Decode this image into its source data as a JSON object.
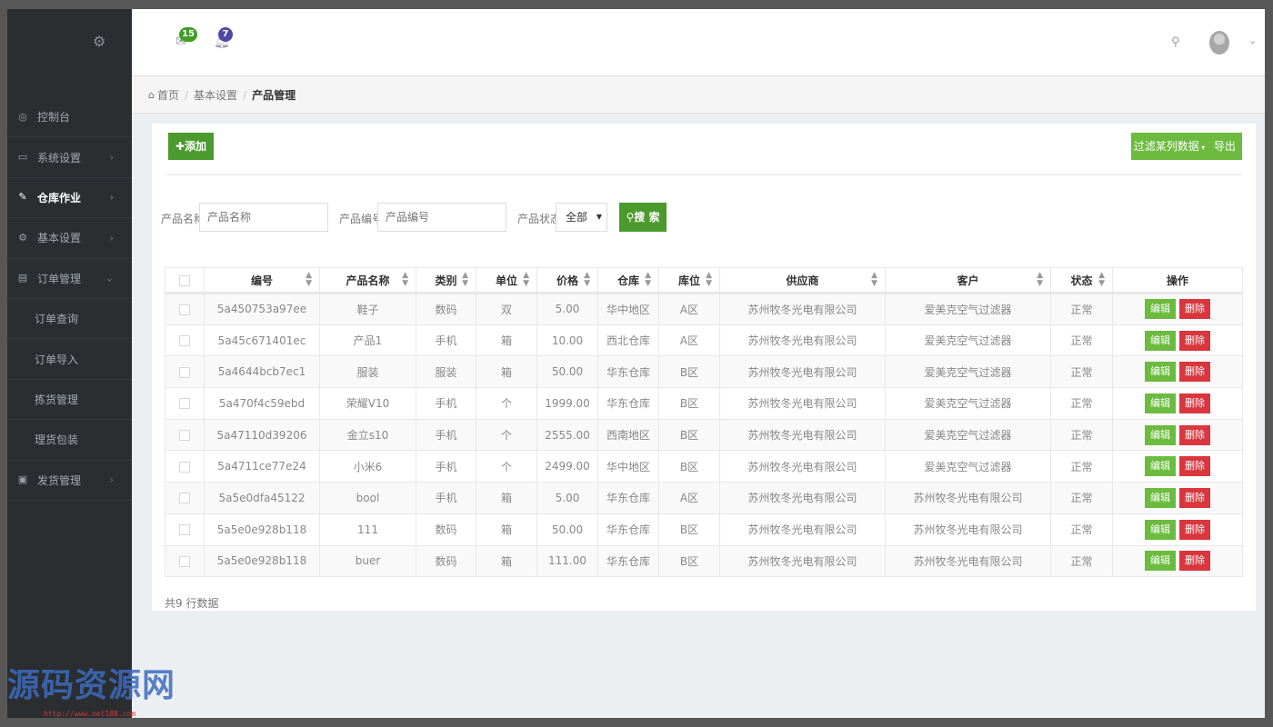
{
  "header": {
    "mail_badge": "15",
    "bell_badge": "7"
  },
  "sidebar": {
    "items": [
      {
        "label": "控制台",
        "icon": "dashboard-icon"
      },
      {
        "label": "系统设置",
        "icon": "monitor-icon"
      },
      {
        "label": "仓库作业",
        "icon": "edit-icon",
        "active": true
      },
      {
        "label": "基本设置",
        "icon": "gear-icon"
      },
      {
        "label": "订单管理",
        "icon": "file-icon",
        "expanded": true
      },
      {
        "label": "订单查询"
      },
      {
        "label": "订单导入"
      },
      {
        "label": "拣货管理"
      },
      {
        "label": "理货包装"
      },
      {
        "label": "发货管理",
        "icon": "truck-icon"
      }
    ]
  },
  "breadcrumb": {
    "home": "首页",
    "level1": "基本设置",
    "current": "产品管理"
  },
  "toolbar": {
    "add_label": "添加",
    "filter_label": "过滤某列数据",
    "export_label": "导出"
  },
  "search": {
    "name_label": "产品名称",
    "name_placeholder": "产品名称",
    "code_label": "产品编号",
    "code_placeholder": "产品编号",
    "status_label": "产品状态",
    "status_value": "全部",
    "search_label": "搜 索"
  },
  "table": {
    "columns": [
      "编号",
      "产品名称",
      "类别",
      "单位",
      "价格",
      "仓库",
      "库位",
      "供应商",
      "客户",
      "状态",
      "操作"
    ],
    "edit_label": "编辑",
    "delete_label": "删除",
    "rows": [
      [
        "5a450753a97ee",
        "鞋子",
        "数码",
        "双",
        "5.00",
        "华中地区",
        "A区",
        "苏州牧冬光电有限公司",
        "爱美克空气过滤器",
        "正常"
      ],
      [
        "5a45c671401ec",
        "产品1",
        "手机",
        "箱",
        "10.00",
        "西北仓库",
        "A区",
        "苏州牧冬光电有限公司",
        "爱美克空气过滤器",
        "正常"
      ],
      [
        "5a4644bcb7ec1",
        "服装",
        "服装",
        "箱",
        "50.00",
        "华东仓库",
        "B区",
        "苏州牧冬光电有限公司",
        "爱美克空气过滤器",
        "正常"
      ],
      [
        "5a470f4c59ebd",
        "荣耀V10",
        "手机",
        "个",
        "1999.00",
        "华东仓库",
        "B区",
        "苏州牧冬光电有限公司",
        "爱美克空气过滤器",
        "正常"
      ],
      [
        "5a47110d39206",
        "金立s10",
        "手机",
        "个",
        "2555.00",
        "西南地区",
        "B区",
        "苏州牧冬光电有限公司",
        "爱美克空气过滤器",
        "正常"
      ],
      [
        "5a4711ce77e24",
        "小米6",
        "手机",
        "个",
        "2499.00",
        "华中地区",
        "B区",
        "苏州牧冬光电有限公司",
        "爱美克空气过滤器",
        "正常"
      ],
      [
        "5a5e0dfa45122",
        "bool",
        "手机",
        "箱",
        "5.00",
        "华东仓库",
        "A区",
        "苏州牧冬光电有限公司",
        "苏州牧冬光电有限公司",
        "正常"
      ],
      [
        "5a5e0e928b118",
        "111",
        "数码",
        "箱",
        "50.00",
        "华东仓库",
        "B区",
        "苏州牧冬光电有限公司",
        "苏州牧冬光电有限公司",
        "正常"
      ],
      [
        "5a5e0e928b118",
        "buer",
        "数码",
        "箱",
        "111.00",
        "华东仓库",
        "B区",
        "苏州牧冬光电有限公司",
        "苏州牧冬光电有限公司",
        "正常"
      ]
    ],
    "total_text": "共9 行数据"
  },
  "watermark": {
    "text": "源码资源网",
    "url": "http://www.net188.com"
  },
  "colors": {
    "sidebar": "#2b2e31",
    "primary_green": "#4a9a2d",
    "light_green": "#6cbb3f",
    "danger": "#d9363e"
  }
}
